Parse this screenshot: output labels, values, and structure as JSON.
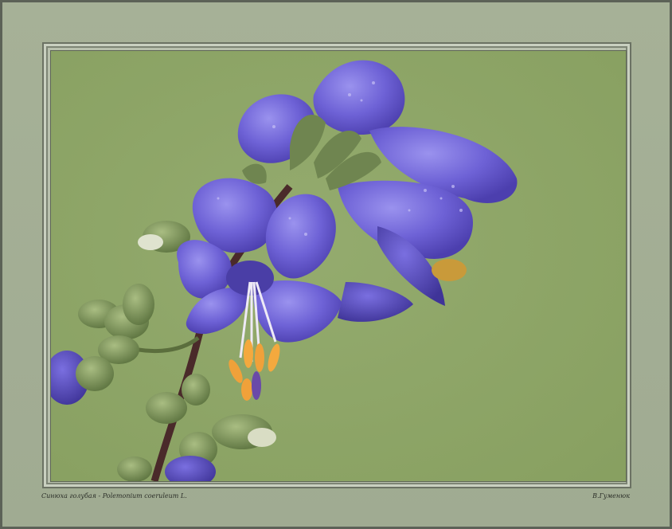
{
  "photo": {
    "subject": "flower-photo",
    "background_color": "#8fa66a",
    "petal_color": "#6a5fd0",
    "stamen_color": "#f0a13a"
  },
  "caption": {
    "species": "Синюха голубая - Polemonium coeruleum L.",
    "author": "В.Гуменюк"
  }
}
